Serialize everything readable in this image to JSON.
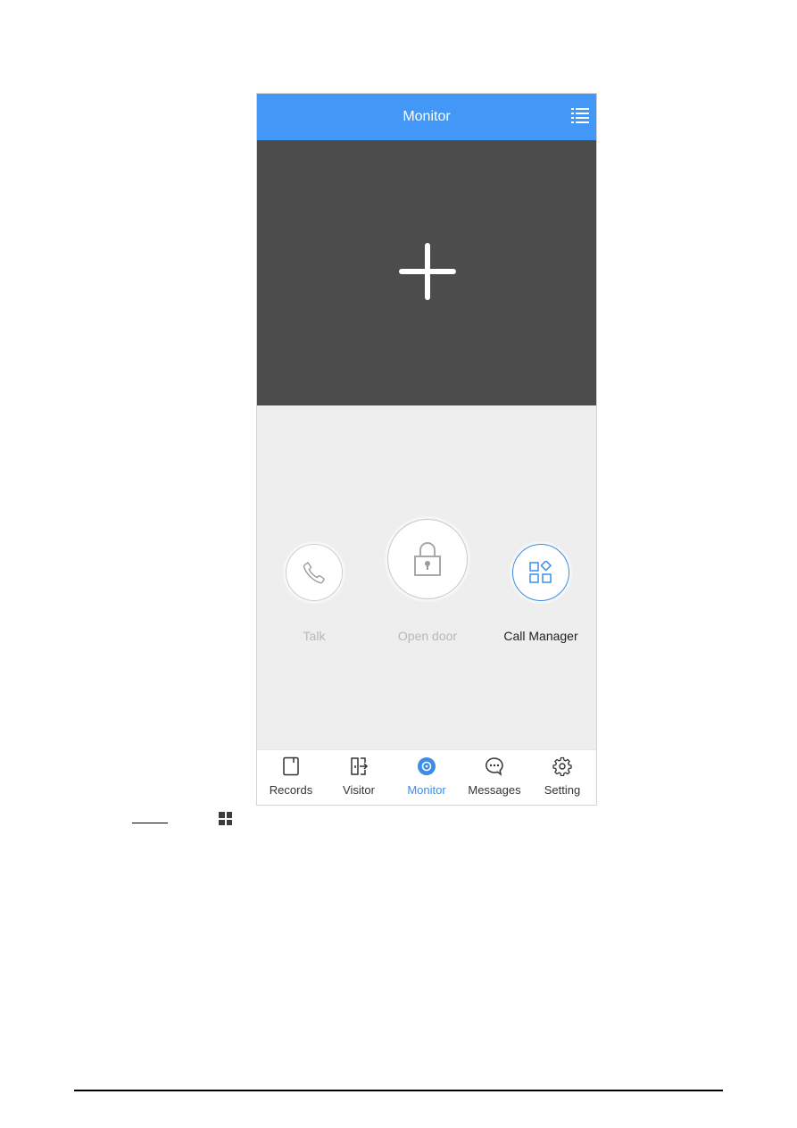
{
  "header": {
    "title": "Monitor",
    "menu_icon": "list-icon"
  },
  "video": {
    "add_icon": "plus-icon"
  },
  "actions": [
    {
      "label": "Talk",
      "icon": "phone-icon",
      "enabled": false
    },
    {
      "label": "Open door",
      "icon": "lock-icon",
      "enabled": false
    },
    {
      "label": "Call Manager",
      "icon": "apps-icon",
      "enabled": true
    }
  ],
  "tabs": [
    {
      "label": "Records",
      "icon": "records-icon",
      "active": false
    },
    {
      "label": "Visitor",
      "icon": "visitor-icon",
      "active": false
    },
    {
      "label": "Monitor",
      "icon": "monitor-icon",
      "active": true
    },
    {
      "label": "Messages",
      "icon": "messages-icon",
      "active": false
    },
    {
      "label": "Setting",
      "icon": "gear-icon",
      "active": false
    }
  ],
  "colors": {
    "accent": "#4297f7",
    "active_tab": "#3d8de8",
    "video_bg": "#4c4c4c",
    "body_bg": "#eeeeee"
  }
}
